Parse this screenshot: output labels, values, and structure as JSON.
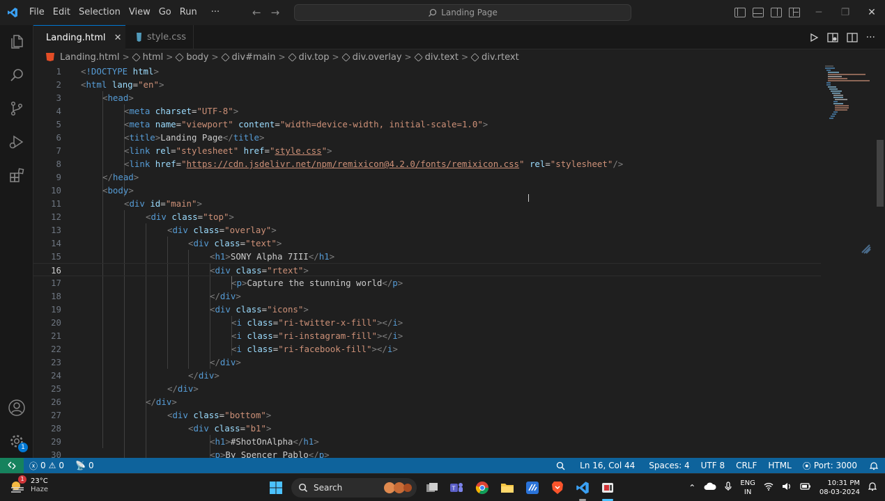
{
  "menu": [
    "File",
    "Edit",
    "Selection",
    "View",
    "Go",
    "Run",
    "···"
  ],
  "command_center": "Landing Page",
  "tabs": [
    {
      "label": "Landing.html",
      "active": true
    },
    {
      "label": "style.css",
      "active": false
    }
  ],
  "breadcrumb": [
    "Landing.html",
    "html",
    "body",
    "div#main",
    "div.top",
    "div.overlay",
    "div.text",
    "div.rtext"
  ],
  "code_lines": [
    "1",
    "2",
    "3",
    "4",
    "5",
    "6",
    "7",
    "8",
    "9",
    "10",
    "11",
    "12",
    "13",
    "14",
    "15",
    "16",
    "17",
    "18",
    "19",
    "20",
    "21",
    "22",
    "23",
    "24",
    "25",
    "26",
    "27",
    "28",
    "29",
    "30"
  ],
  "code": {
    "doctype": "!DOCTYPE",
    "doctype_html": "html",
    "html": "html",
    "lang": "lang",
    "lang_val": "\"en\"",
    "head": "head",
    "meta": "meta",
    "charset": "charset",
    "charset_val": "\"UTF-8\"",
    "name": "name",
    "viewport": "\"viewport\"",
    "content": "content",
    "content_val": "\"width=device-width, initial-scale=1.0\"",
    "title": "title",
    "title_text": "Landing Page",
    "link": "link",
    "rel": "rel",
    "stylesheet": "\"stylesheet\"",
    "href": "href",
    "style_href_q": "\"",
    "style_href": "style.css",
    "cdn_href": "https://cdn.jsdelivr.net/npm/remixicon@4.2.0/fonts/remixicon.css",
    "body": "body",
    "div": "div",
    "id": "id",
    "main_val": "\"main\"",
    "class": "class",
    "top_val": "\"top\"",
    "overlay_val": "\"overlay\"",
    "text_val": "\"text\"",
    "h1": "h1",
    "h1_text": "SONY Alpha 7III",
    "rtext_val": "\"rtext\"",
    "p": "p",
    "p_text": "Capture the stunning world",
    "icons_val": "\"icons\"",
    "i": "i",
    "twitter_val": "\"ri-twitter-x-fill\"",
    "instagram_val": "\"ri-instagram-fill\"",
    "facebook_val": "\"ri-facebook-fill\"",
    "bottom_val": "\"bottom\"",
    "b1_val": "\"b1\"",
    "h1b_text": "#ShotOnAlpha",
    "p2_text": "By Spencer Pablo"
  },
  "status": {
    "errors": "0",
    "warnings": "0",
    "ports": "0",
    "position": "Ln 16, Col 44",
    "spaces": "Spaces: 4",
    "encoding": "UTF 8",
    "eol": "CRLF",
    "language": "HTML",
    "port": "Port: 3000"
  },
  "taskbar": {
    "weather_temp": "23°C",
    "weather_desc": "Haze",
    "weather_badge": "1",
    "search": "Search",
    "lang1": "ENG",
    "lang2": "IN",
    "time": "10:31 PM",
    "date": "08-03-2024"
  },
  "accounts_badge": "1",
  "colors": {
    "accent": "#0078d4",
    "statusbar": "#0e639c",
    "remote": "#16825d",
    "html_icon": "#e44d26",
    "css_icon": "#519aba"
  }
}
